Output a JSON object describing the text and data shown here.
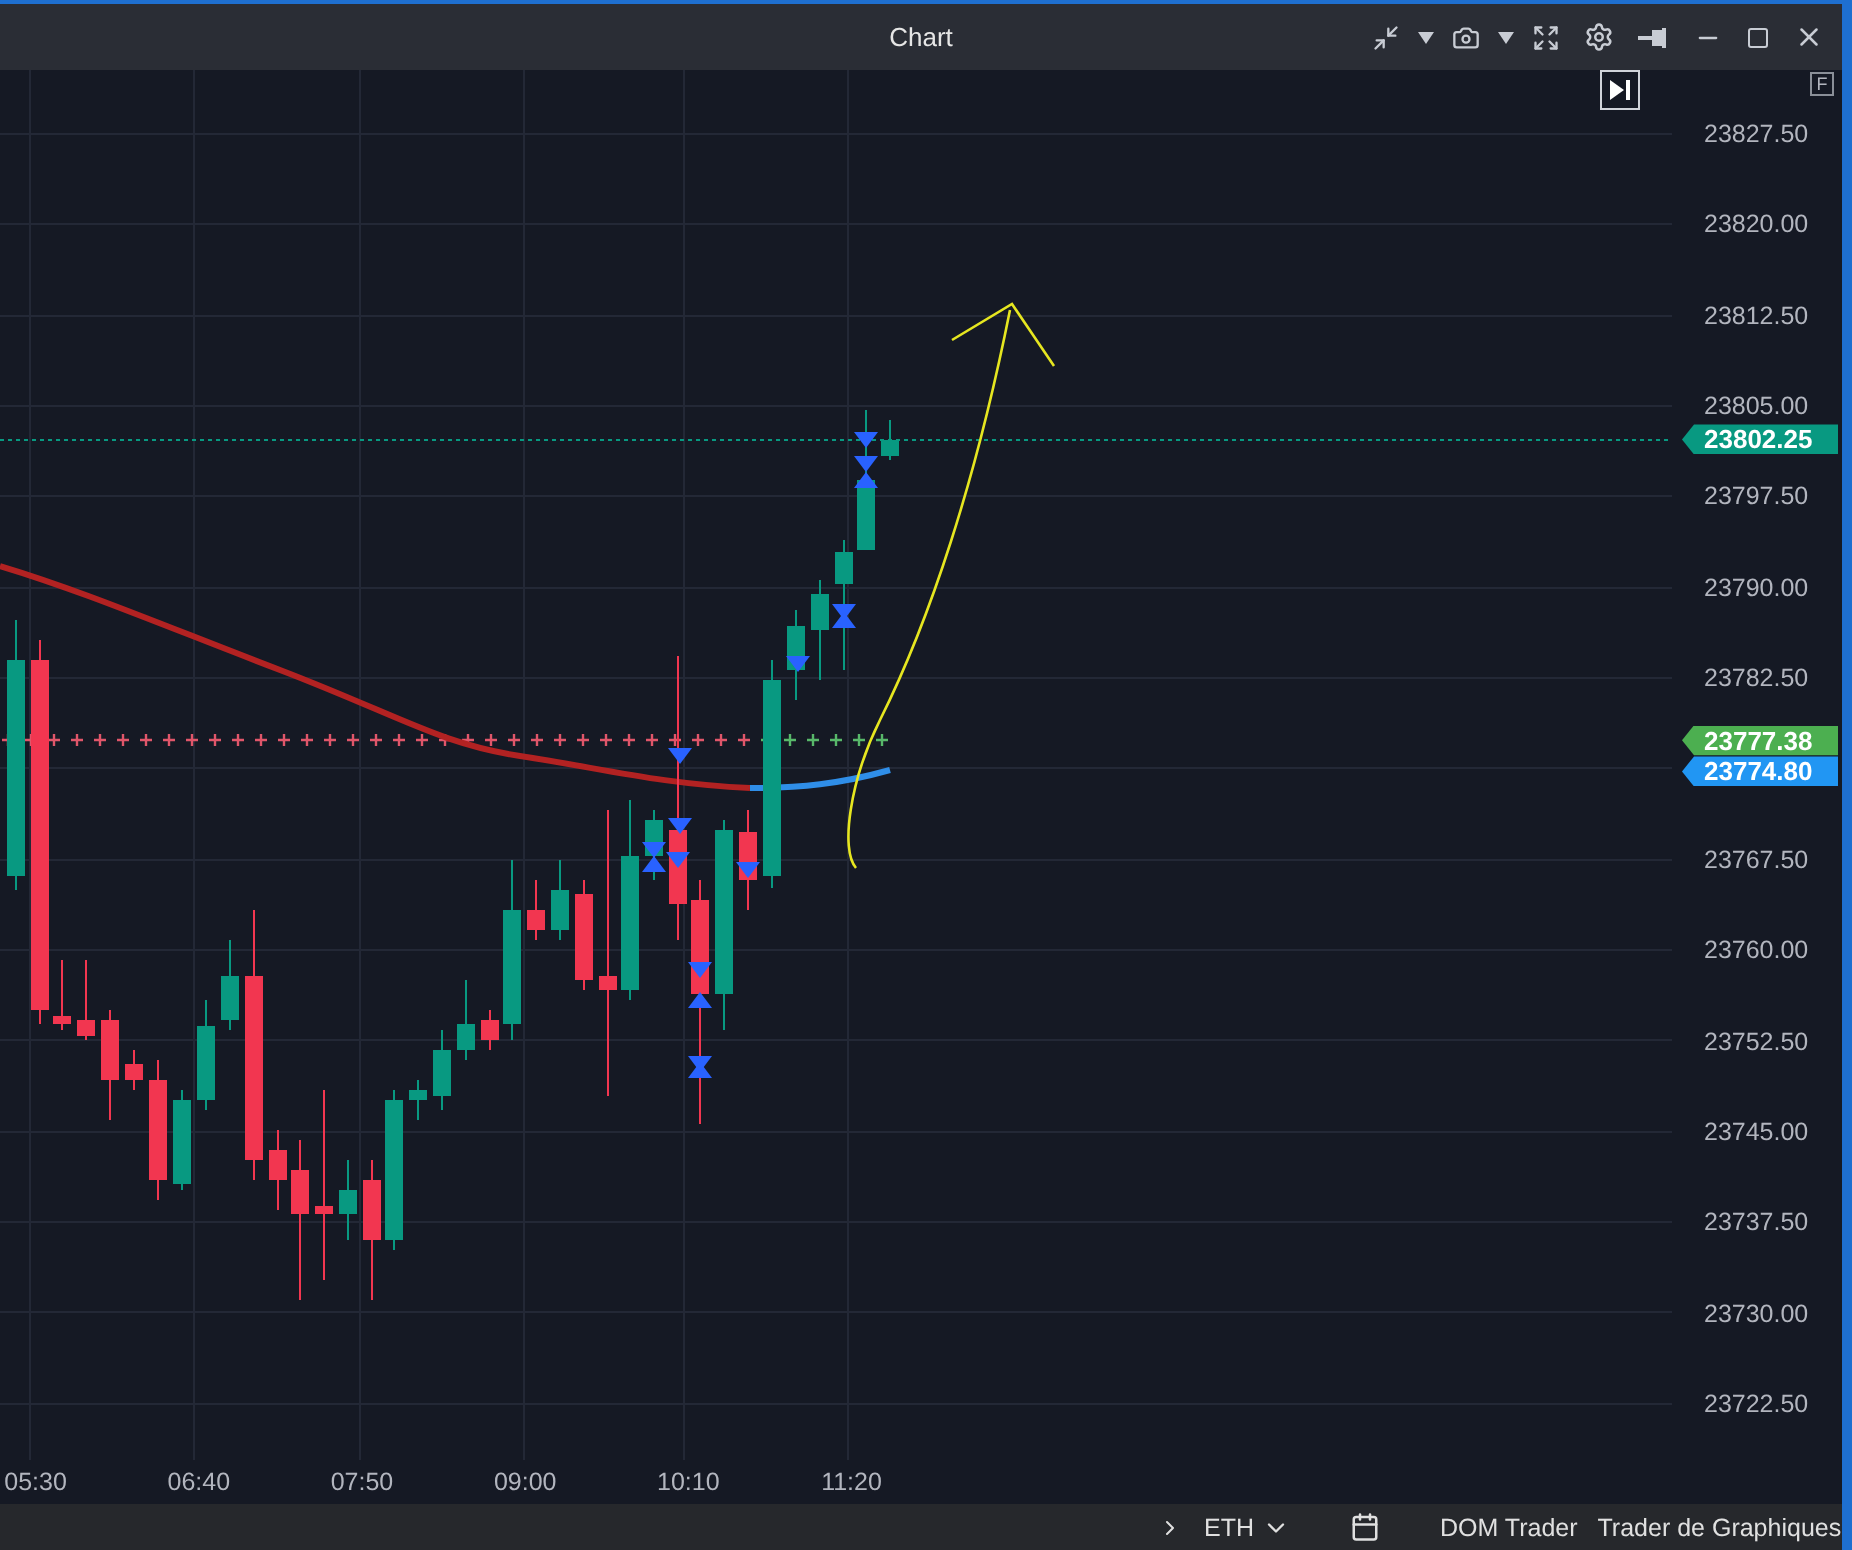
{
  "window": {
    "title": "Chart"
  },
  "chart": {
    "badge": "F",
    "price_labels": [
      "23827.50",
      "23820.00",
      "23812.50",
      "23805.00",
      "23797.50",
      "23790.00",
      "23782.50",
      "23767.50",
      "23760.00",
      "23752.50",
      "23745.00",
      "23737.50",
      "23730.00",
      "23722.50"
    ],
    "price_tags": [
      {
        "value": "23802.25",
        "color": "#089981"
      },
      {
        "value": "23777.38",
        "color": "#4caf50"
      },
      {
        "value": "23774.80",
        "color": "#2196f3"
      }
    ],
    "time_labels": [
      "05:30",
      "06:40",
      "07:50",
      "09:00",
      "10:10",
      "11:20"
    ]
  },
  "status_bar": {
    "instrument": "ETH",
    "buttons": [
      "DOM Trader",
      "Trader de Graphiques"
    ]
  }
}
